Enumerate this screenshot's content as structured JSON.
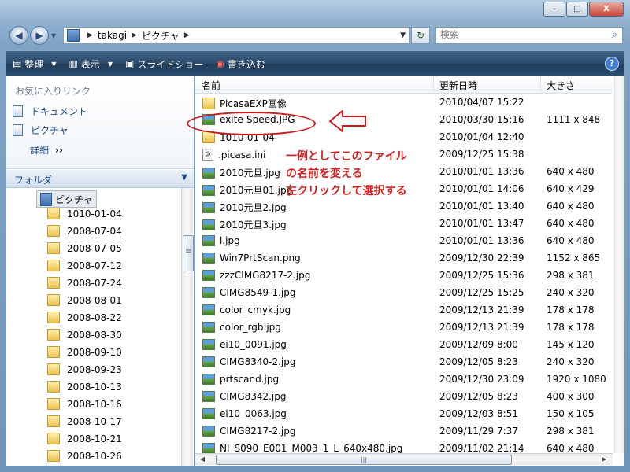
{
  "window": {
    "minimize": "–",
    "maximize": "□",
    "close": "X"
  },
  "address": {
    "crumbs": [
      "takagi",
      "ピクチャ"
    ]
  },
  "search": {
    "placeholder": "検索"
  },
  "toolbar": {
    "organize": "整理",
    "view": "表示",
    "slideshow": "スライドショー",
    "burn": "書き込む",
    "help": "?"
  },
  "favorites": {
    "header": "お気に入りリンク",
    "items": [
      "ドキュメント",
      "ピクチャ"
    ],
    "more": "詳細"
  },
  "folders": {
    "header": "フォルダ",
    "selected": "ピクチャ",
    "items": [
      "1010-01-04",
      "2008-07-04",
      "2008-07-05",
      "2008-07-12",
      "2008-07-24",
      "2008-08-01",
      "2008-08-22",
      "2008-08-30",
      "2008-09-10",
      "2008-09-23",
      "2008-10-13",
      "2008-10-16",
      "2008-10-17",
      "2008-10-21",
      "2008-10-26"
    ]
  },
  "columns": {
    "name": "名前",
    "date": "更新日時",
    "size": "大きさ"
  },
  "files": [
    {
      "name": "PicasaEXP画像",
      "date": "2010/04/07 15:22",
      "size": "",
      "icon": "folder-icon"
    },
    {
      "name": "exite-Speed.JPG",
      "date": "2010/03/30 15:16",
      "size": "1111 x 848",
      "icon": "image-icon"
    },
    {
      "name": "1010-01-04",
      "date": "2010/01/04 12:40",
      "size": "",
      "icon": "folder-icon"
    },
    {
      "name": ".picasa.ini",
      "date": "2009/12/25 15:38",
      "size": "",
      "icon": "settings-file-icon"
    },
    {
      "name": "2010元旦.jpg",
      "date": "2010/01/01 13:36",
      "size": "640 x 480",
      "icon": "image-icon"
    },
    {
      "name": "2010元旦01.jpg",
      "date": "2010/01/01 14:06",
      "size": "640 x 429",
      "icon": "image-icon"
    },
    {
      "name": "2010元旦2.jpg",
      "date": "2010/01/01 13:40",
      "size": "640 x 480",
      "icon": "image-icon"
    },
    {
      "name": "2010元旦3.jpg",
      "date": "2010/01/01 13:47",
      "size": "640 x 480",
      "icon": "image-icon"
    },
    {
      "name": "l.jpg",
      "date": "2010/01/01 13:36",
      "size": "640 x 480",
      "icon": "image-icon"
    },
    {
      "name": "Win7PrtScan.png",
      "date": "2009/12/30 22:39",
      "size": "1152 x 865",
      "icon": "image-icon"
    },
    {
      "name": "zzzCIMG8217-2.jpg",
      "date": "2009/12/25 15:36",
      "size": "298 x 381",
      "icon": "image-icon"
    },
    {
      "name": "CIMG8549-1.jpg",
      "date": "2009/12/25 15:25",
      "size": "240 x 320",
      "icon": "image-icon"
    },
    {
      "name": "color_cmyk.jpg",
      "date": "2009/12/13 21:39",
      "size": "178 x 178",
      "icon": "image-icon"
    },
    {
      "name": "color_rgb.jpg",
      "date": "2009/12/13 21:39",
      "size": "178 x 178",
      "icon": "image-icon"
    },
    {
      "name": "ei10_0091.jpg",
      "date": "2009/12/09 8:00",
      "size": "145 x 120",
      "icon": "image-icon"
    },
    {
      "name": "CIMG8340-2.jpg",
      "date": "2009/12/05 8:23",
      "size": "240 x 320",
      "icon": "image-icon"
    },
    {
      "name": "prtscand.jpg",
      "date": "2009/12/30 23:09",
      "size": "1920 x 1080",
      "icon": "image-icon"
    },
    {
      "name": "CIMG8342.jpg",
      "date": "2009/12/05 8:23",
      "size": "400 x 300",
      "icon": "image-icon"
    },
    {
      "name": "ei10_0063.jpg",
      "date": "2009/12/03 8:51",
      "size": "150 x 105",
      "icon": "image-icon"
    },
    {
      "name": "CIMG8217-2.jpg",
      "date": "2009/11/29 7:37",
      "size": "298 x 381",
      "icon": "image-icon"
    },
    {
      "name": "NI_S090_E001_M003_1_L_640x480.jpg",
      "date": "2009/11/02 21:14",
      "size": "640 x 480",
      "icon": "image-icon"
    }
  ],
  "annotation": {
    "lines": [
      "一例としてこのファイル",
      "の名前を変える",
      "左クリックして選択する"
    ],
    "color": "#d02020"
  }
}
